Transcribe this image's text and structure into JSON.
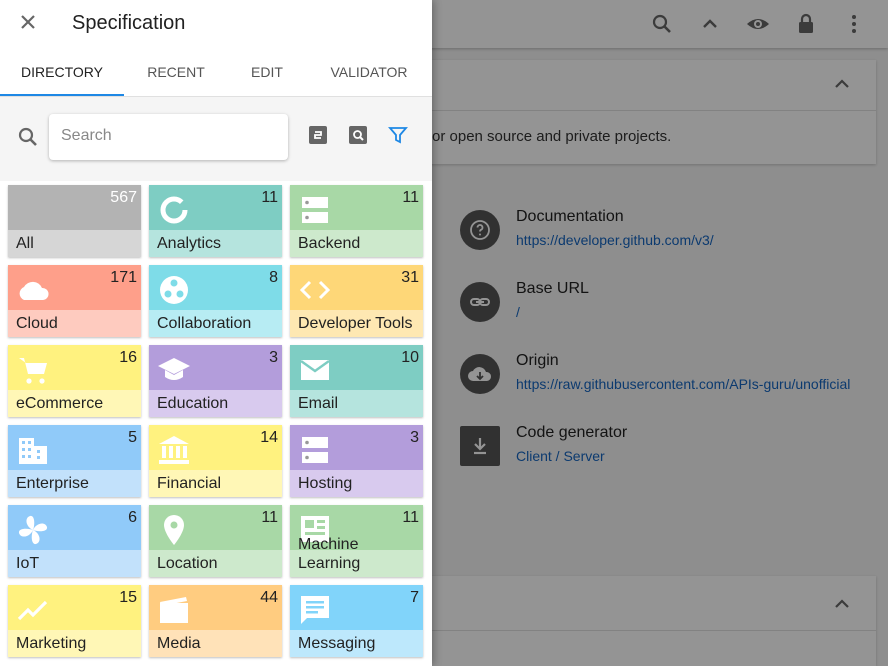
{
  "drawer": {
    "title": "Specification",
    "tabs": [
      "DIRECTORY",
      "RECENT",
      "EDIT",
      "VALIDATOR"
    ],
    "active_tab": "DIRECTORY",
    "search_placeholder": "Search"
  },
  "background": {
    "description": "or open source and private projects.",
    "info": [
      {
        "label": "Documentation",
        "value": "https://developer.github.com/v3/",
        "icon": "help-icon"
      },
      {
        "label": "Base URL",
        "value": "/",
        "icon": "link-icon"
      },
      {
        "label": "Origin",
        "value": "https://raw.githubusercontent.com/APIs-guru/unofficial",
        "icon": "cloud-download-icon"
      },
      {
        "label": "Code generator",
        "value": "Client / Server",
        "icon": "download-icon"
      }
    ]
  },
  "categories": [
    {
      "label": "All",
      "count": "567",
      "icon": "none",
      "top": "#b3b3b3",
      "bottom": "#d6d6d6"
    },
    {
      "label": "Analytics",
      "count": "11",
      "icon": "donut-icon",
      "top": "#7ecdc3",
      "bottom": "#b5e4de"
    },
    {
      "label": "Backend",
      "count": "11",
      "icon": "server-icon",
      "top": "#a8d8a6",
      "bottom": "#cde9cc"
    },
    {
      "label": "Cloud",
      "count": "171",
      "icon": "cloud-icon",
      "top": "#fe9f8a",
      "bottom": "#fecbbf"
    },
    {
      "label": "Collaboration",
      "count": "8",
      "icon": "collaboration-icon",
      "top": "#7edce8",
      "bottom": "#b7ecf3"
    },
    {
      "label": "Developer Tools",
      "count": "31",
      "icon": "code-icon",
      "top": "#fed778",
      "bottom": "#fee8b2"
    },
    {
      "label": "eCommerce",
      "count": "16",
      "icon": "cart-icon",
      "top": "#fff27f",
      "bottom": "#fff7b6"
    },
    {
      "label": "Education",
      "count": "3",
      "icon": "school-icon",
      "top": "#b39ddb",
      "bottom": "#d8caee"
    },
    {
      "label": "Email",
      "count": "10",
      "icon": "email-icon",
      "top": "#7ecdc3",
      "bottom": "#b5e4de"
    },
    {
      "label": "Enterprise",
      "count": "5",
      "icon": "building-icon",
      "top": "#90caf9",
      "bottom": "#c2e1fb"
    },
    {
      "label": "Financial",
      "count": "14",
      "icon": "bank-icon",
      "top": "#fff27f",
      "bottom": "#fff7b6"
    },
    {
      "label": "Hosting",
      "count": "3",
      "icon": "server-icon",
      "top": "#b39ddb",
      "bottom": "#d8caee"
    },
    {
      "label": "IoT",
      "count": "6",
      "icon": "fan-icon",
      "top": "#90caf9",
      "bottom": "#c2e1fb"
    },
    {
      "label": "Location",
      "count": "11",
      "icon": "pin-icon",
      "top": "#a8d8a6",
      "bottom": "#cde9cc"
    },
    {
      "label": "Machine Learning",
      "count": "11",
      "icon": "dashboard-icon",
      "top": "#a8d8a6",
      "bottom": "#cde9cc"
    },
    {
      "label": "Marketing",
      "count": "15",
      "icon": "trending-icon",
      "top": "#fff27f",
      "bottom": "#fff7b6"
    },
    {
      "label": "Media",
      "count": "44",
      "icon": "movie-icon",
      "top": "#ffcc80",
      "bottom": "#ffe2b8"
    },
    {
      "label": "Messaging",
      "count": "7",
      "icon": "message-icon",
      "top": "#81d4fa",
      "bottom": "#bde8fc"
    }
  ]
}
